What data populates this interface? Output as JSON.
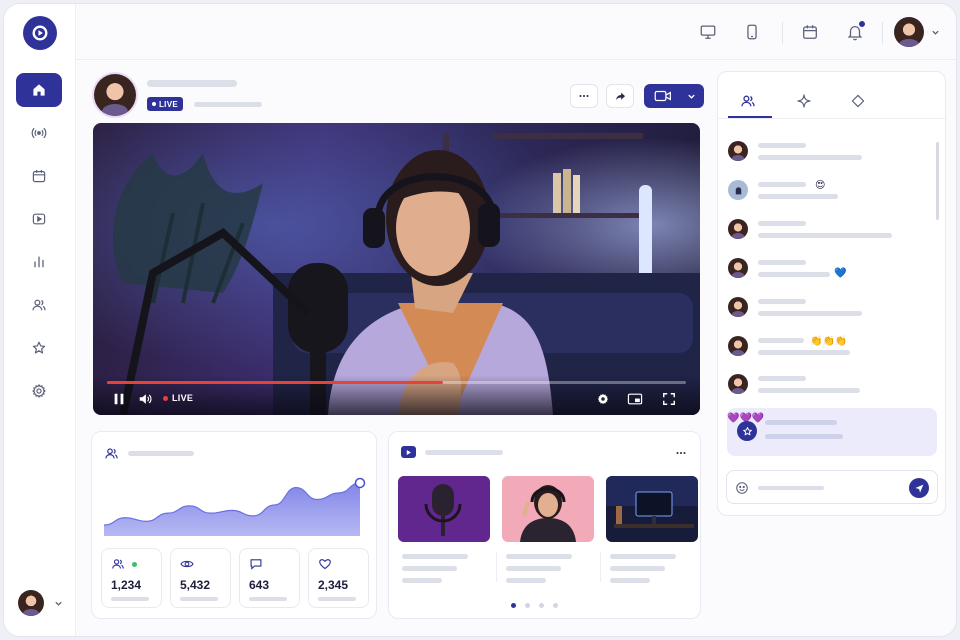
{
  "app": {
    "accent": "#2f3399",
    "live_red": "#e5423a"
  },
  "sidebar": {
    "logo": "play-logo-icon",
    "items": [
      {
        "id": "home",
        "icon": "home-icon",
        "active": true
      },
      {
        "id": "broadcast",
        "icon": "broadcast-icon"
      },
      {
        "id": "calendar",
        "icon": "calendar-icon"
      },
      {
        "id": "videos",
        "icon": "video-play-icon"
      },
      {
        "id": "analytics",
        "icon": "bar-chart-icon"
      },
      {
        "id": "audience",
        "icon": "users-icon"
      },
      {
        "id": "favorites",
        "icon": "star-icon"
      },
      {
        "id": "settings",
        "icon": "gear-icon"
      }
    ]
  },
  "header": {
    "icons": [
      "desktop-icon",
      "mobile-icon",
      "calendar-icon",
      "bell-icon"
    ],
    "has_notification": true
  },
  "stream": {
    "badge": "LIVE",
    "control_live_label": "LIVE",
    "progress": 0.58
  },
  "stats": [
    {
      "icon": "viewers-icon",
      "value": "1,234",
      "online": true
    },
    {
      "icon": "eye-icon",
      "value": "5,432"
    },
    {
      "icon": "comment-icon",
      "value": "643"
    },
    {
      "icon": "heart-icon",
      "value": "2,345"
    }
  ],
  "chart_data": {
    "type": "area",
    "x": [
      0,
      1,
      2,
      3,
      4,
      5,
      6,
      7,
      8,
      9,
      10,
      11,
      12
    ],
    "values": [
      12,
      20,
      16,
      25,
      33,
      25,
      28,
      22,
      34,
      53,
      40,
      47,
      58
    ],
    "ylim": [
      0,
      70
    ],
    "grid": false,
    "color": "#7b7fe6"
  },
  "chat": {
    "tabs": [
      {
        "id": "people",
        "icon": "users-icon",
        "active": true
      },
      {
        "id": "effects",
        "icon": "sparkle-icon"
      },
      {
        "id": "shapes",
        "icon": "diamond-icon"
      }
    ],
    "messages": [
      {
        "emoji": ""
      },
      {
        "emoji": "😍"
      },
      {
        "emoji": ""
      },
      {
        "emoji": "💙"
      },
      {
        "emoji": ""
      },
      {
        "emoji": "👏👏👏"
      },
      {
        "emoji": ""
      }
    ],
    "highlight_emoji": "💜💜💜",
    "composer_icons": [
      "smiley-icon",
      "send-icon"
    ]
  },
  "carousel": {
    "pages": 4,
    "active": 0
  }
}
